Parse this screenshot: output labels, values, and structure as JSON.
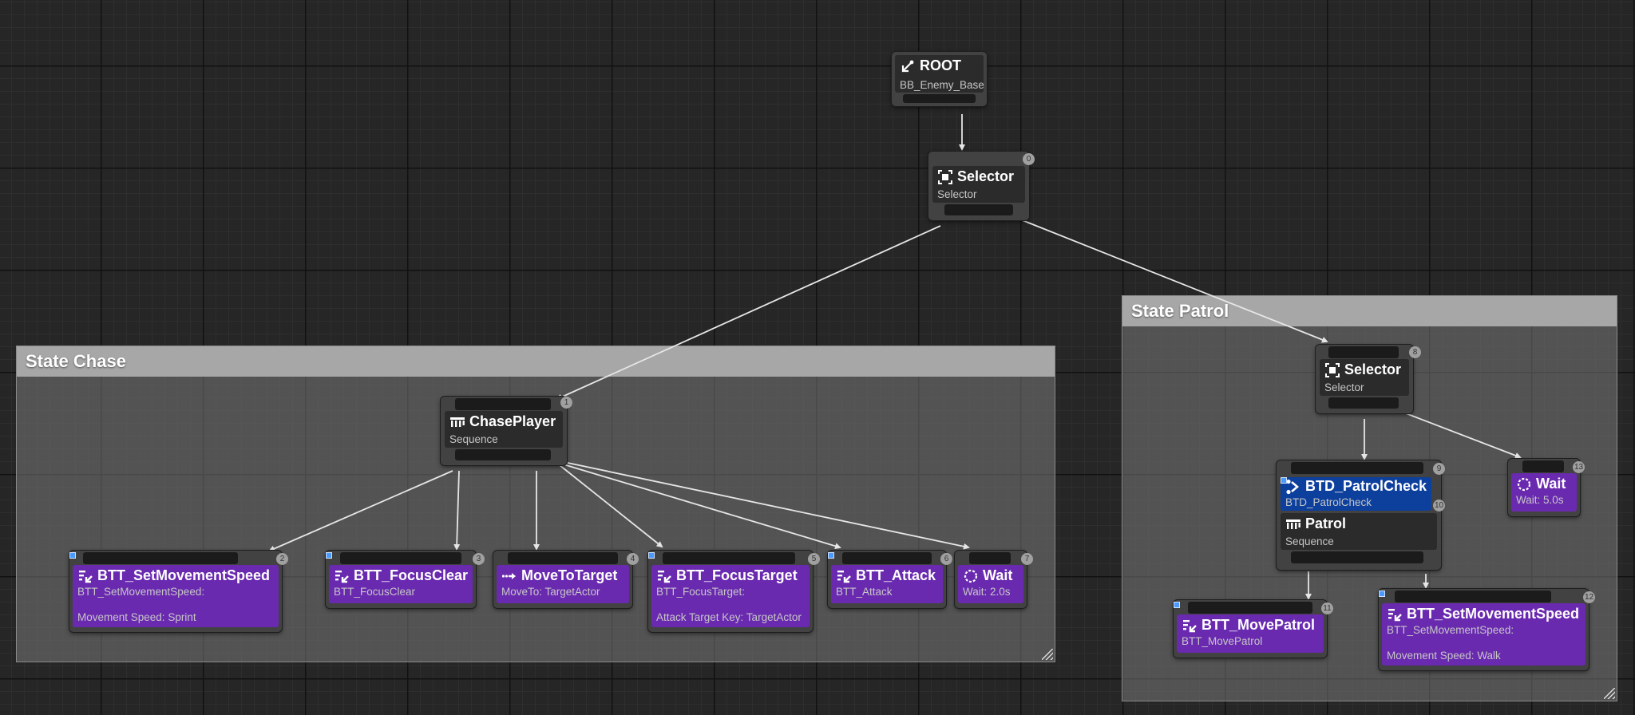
{
  "comments": {
    "chase": {
      "label": "State Chase"
    },
    "patrol": {
      "label": "State Patrol"
    }
  },
  "nodes": {
    "root": {
      "title": "ROOT",
      "subtitle": "BB_Enemy_Base",
      "icon": "root-icon"
    },
    "selector_main": {
      "title": "Selector",
      "subtitle": "Selector",
      "index": "0",
      "icon": "selector-icon"
    },
    "chase_player": {
      "title": "ChasePlayer",
      "subtitle": "Sequence",
      "index": "1",
      "icon": "sequence-icon"
    },
    "set_speed_sprint": {
      "title": "BTT_SetMovementSpeed",
      "subtitle": "BTT_SetMovementSpeed:",
      "detail": "Movement Speed: Sprint",
      "index": "2",
      "icon": "task-icon"
    },
    "focus_clear": {
      "title": "BTT_FocusClear",
      "subtitle": "BTT_FocusClear",
      "index": "3",
      "icon": "task-icon"
    },
    "move_to_target": {
      "title": "MoveToTarget",
      "subtitle": "MoveTo: TargetActor",
      "index": "4",
      "icon": "move-to-icon"
    },
    "focus_target": {
      "title": "BTT_FocusTarget",
      "subtitle": "BTT_FocusTarget:",
      "detail": "Attack Target Key: TargetActor",
      "index": "5",
      "icon": "task-icon"
    },
    "attack": {
      "title": "BTT_Attack",
      "subtitle": "BTT_Attack",
      "index": "6",
      "icon": "task-icon"
    },
    "wait_chase": {
      "title": "Wait",
      "subtitle": "Wait: 2.0s",
      "index": "7",
      "icon": "wait-icon"
    },
    "selector_patrol": {
      "title": "Selector",
      "subtitle": "Selector",
      "index": "8",
      "icon": "selector-icon"
    },
    "patrol_check": {
      "title": "BTD_PatrolCheck",
      "subtitle": "BTD_PatrolCheck",
      "index": "9",
      "icon": "decorator-icon"
    },
    "patrol": {
      "title": "Patrol",
      "subtitle": "Sequence",
      "index": "10",
      "icon": "sequence-icon"
    },
    "move_patrol": {
      "title": "BTT_MovePatrol",
      "subtitle": "BTT_MovePatrol",
      "index": "11",
      "icon": "task-icon"
    },
    "set_speed_walk": {
      "title": "BTT_SetMovementSpeed",
      "subtitle": "BTT_SetMovementSpeed:",
      "detail": "Movement Speed: Walk",
      "index": "12",
      "icon": "task-icon"
    },
    "wait_patrol": {
      "title": "Wait",
      "subtitle": "Wait: 5.0s",
      "index": "13",
      "icon": "wait-icon"
    }
  },
  "colors": {
    "canvas_bg": "#262626",
    "task_node": "#6a2ab0",
    "decorator_node": "#0d3f9c",
    "composite_node": "#2b2b2b",
    "wire": "#e6e6e6",
    "comment_header": "#a7a7a7"
  }
}
